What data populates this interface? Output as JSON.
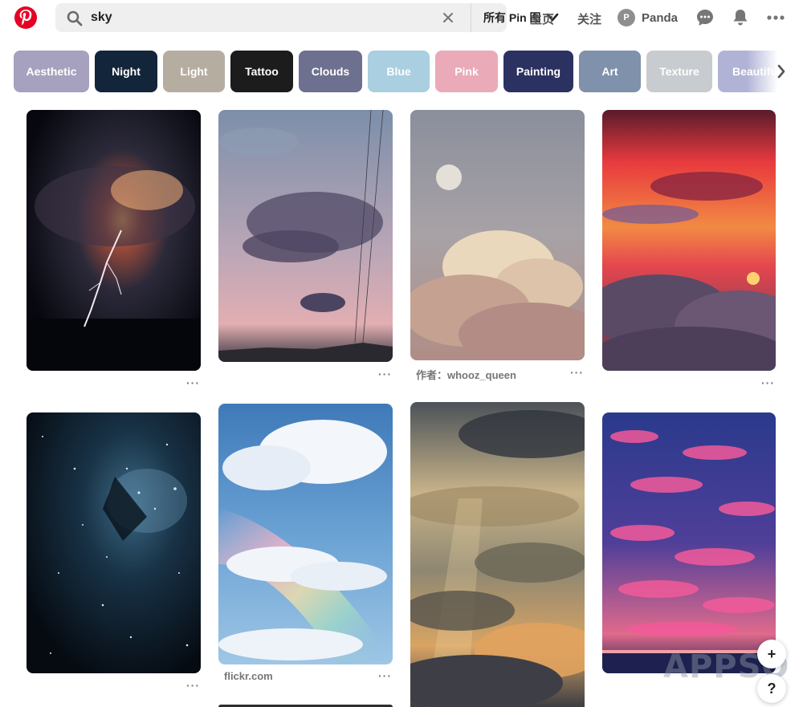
{
  "header": {
    "search_value": "sky",
    "scope_label": "所有 Pin 图",
    "nav": {
      "home": "主页",
      "following": "关注"
    },
    "user": {
      "initial": "P",
      "name": "Panda"
    },
    "brand_color": "#e60023"
  },
  "categories": [
    {
      "label": "Aesthetic",
      "color": "#a6a1be"
    },
    {
      "label": "Night",
      "color": "#13253a"
    },
    {
      "label": "Light",
      "color": "#b6ada1"
    },
    {
      "label": "Tattoo",
      "color": "#1c1c1c"
    },
    {
      "label": "Clouds",
      "color": "#6e7090"
    },
    {
      "label": "Blue",
      "color": "#a9cfe0"
    },
    {
      "label": "Pink",
      "color": "#ebaab8"
    },
    {
      "label": "Painting",
      "color": "#2b3161"
    },
    {
      "label": "Art",
      "color": "#7f91ab"
    },
    {
      "label": "Texture",
      "color": "#c8cbcf"
    },
    {
      "label": "Beautiful",
      "color": "#b1b3d6"
    }
  ],
  "pins": [
    {
      "name": "lightning-storm-pin",
      "caption": ""
    },
    {
      "name": "dusk-clouds-pin",
      "caption": ""
    },
    {
      "name": "moon-clouds-pin",
      "caption": "作者：whooz_queen"
    },
    {
      "name": "red-sunset-pin",
      "caption": ""
    },
    {
      "name": "starry-nebula-pin",
      "caption": ""
    },
    {
      "name": "rainbow-clouds-pin",
      "caption": "flickr.com"
    },
    {
      "name": "golden-sunbeam-pin",
      "caption": ""
    },
    {
      "name": "pink-blue-clouds-pin",
      "caption": ""
    }
  ],
  "more_label": "···",
  "float": {
    "add": "+",
    "help": "?"
  },
  "watermark": "APPSO"
}
